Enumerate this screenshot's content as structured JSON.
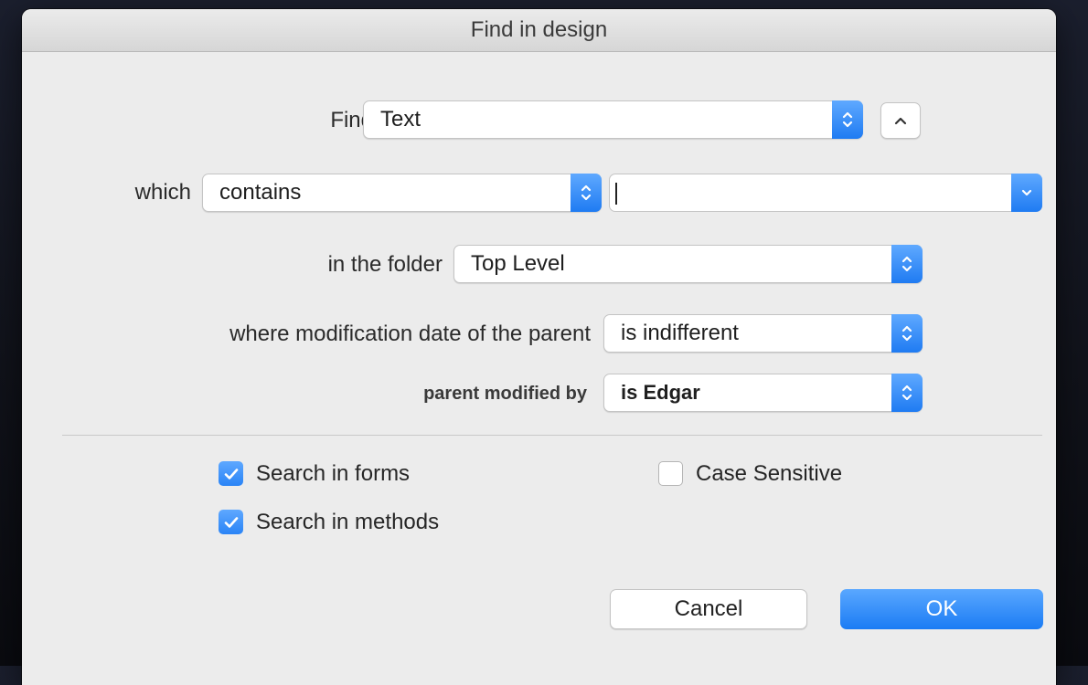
{
  "window": {
    "title": "Find in design"
  },
  "find": {
    "label": "Find",
    "value": "Text",
    "collapse_icon": "chevron-up-icon"
  },
  "which": {
    "label": "which",
    "operator": "contains",
    "search_value": "",
    "combo_icon": "chevron-down-icon"
  },
  "folder": {
    "label": "in the folder",
    "value": "Top Level"
  },
  "mod_date": {
    "label": "where modification date of the parent",
    "value": "is indifferent"
  },
  "modified_by": {
    "label": "parent modified by",
    "value": "is Edgar"
  },
  "options": {
    "search_forms": {
      "label": "Search in forms",
      "checked": true
    },
    "search_methods": {
      "label": "Search in methods",
      "checked": true
    },
    "case_sensitive": {
      "label": "Case Sensitive",
      "checked": false
    }
  },
  "buttons": {
    "cancel": "Cancel",
    "ok": "OK"
  },
  "colors": {
    "accent": "#2a84f6",
    "background": "#ececec"
  }
}
